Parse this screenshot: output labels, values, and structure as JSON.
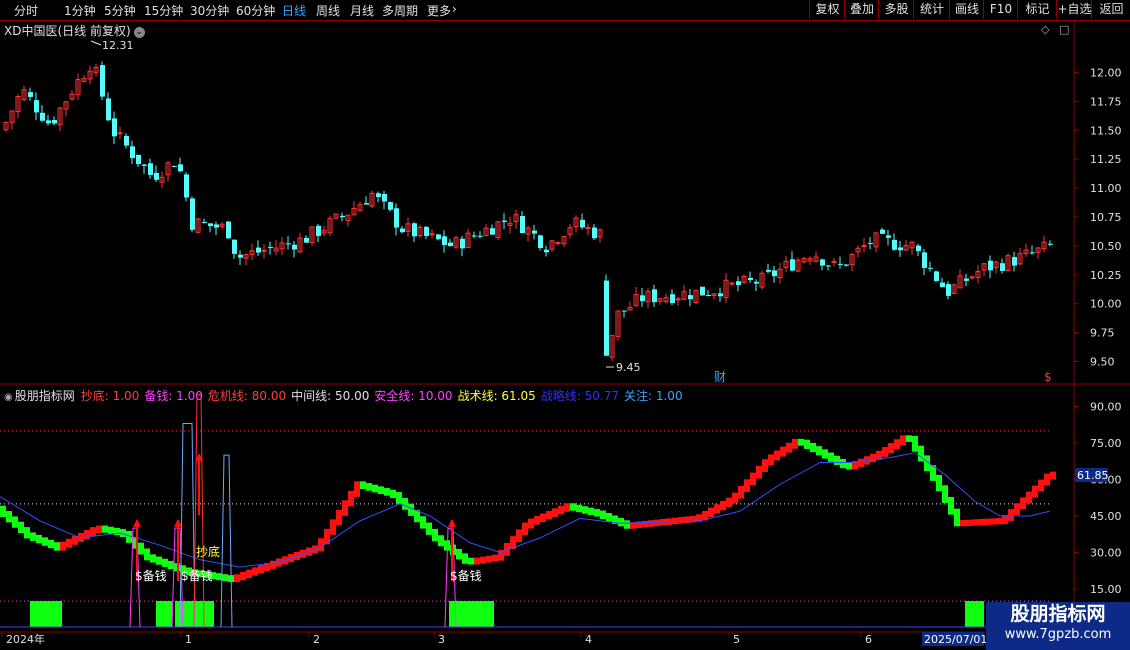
{
  "toolbar": {
    "timeframes": [
      "分时",
      "1分钟",
      "5分钟",
      "15分钟",
      "30分钟",
      "60分钟",
      "日线",
      "周线",
      "月线",
      "多周期",
      "更多"
    ],
    "active_timeframe": "日线",
    "buttons": [
      "复权",
      "叠加",
      "多股",
      "统计",
      "画线",
      "F10",
      "+自选",
      "返回"
    ],
    "marks_label": "标记"
  },
  "main_chart": {
    "title": "XD中国医(日线 前复权)",
    "price_axis": [
      "12.00",
      "11.75",
      "11.50",
      "11.25",
      "11.00",
      "10.75",
      "10.50",
      "10.25",
      "10.00",
      "9.75",
      "9.50"
    ],
    "high_label": "12.31",
    "low_label": "9.45",
    "cai_marker": "财",
    "s_marker": "$",
    "colors": {
      "up": "#ff3232",
      "down": "#54fcfc",
      "axis": "#8b0000"
    }
  },
  "indicator": {
    "name": "股朋指标网",
    "params": [
      {
        "label": "抄底:",
        "value": "1.00",
        "color": "#ff3c3c"
      },
      {
        "label": "备钱:",
        "value": "1.00",
        "color": "#ff40ff"
      },
      {
        "label": "危机线:",
        "value": "80.00",
        "color": "#ff3c3c"
      },
      {
        "label": "中间线:",
        "value": "50.00",
        "color": "#e0e0e0"
      },
      {
        "label": "安全线:",
        "value": "10.00",
        "color": "#ff40ff"
      },
      {
        "label": "战术线:",
        "value": "61.05",
        "color": "#ffff40"
      },
      {
        "label": "战略线:",
        "value": "50.77",
        "color": "#3030ff"
      },
      {
        "label": "关注:",
        "value": "1.00",
        "color": "#40a0ff"
      }
    ],
    "value_axis": [
      "90.00",
      "75.00",
      "61.85",
      "60.00",
      "45.00",
      "30.00",
      "15.00"
    ],
    "current_value": "61.85",
    "signal_labels": [
      "$备钱",
      "$备钱",
      "抄底",
      "$备钱"
    ],
    "colors": {
      "up": "#ff1010",
      "down": "#10ff10",
      "strategic": "#3050ff"
    }
  },
  "time_axis": {
    "labels": [
      "2024年",
      "1",
      "2",
      "3",
      "4",
      "5",
      "6"
    ],
    "current_date": "2025/07/01"
  },
  "watermark": {
    "title": "股朋指标网",
    "url": "www.7gpzb.com"
  }
}
